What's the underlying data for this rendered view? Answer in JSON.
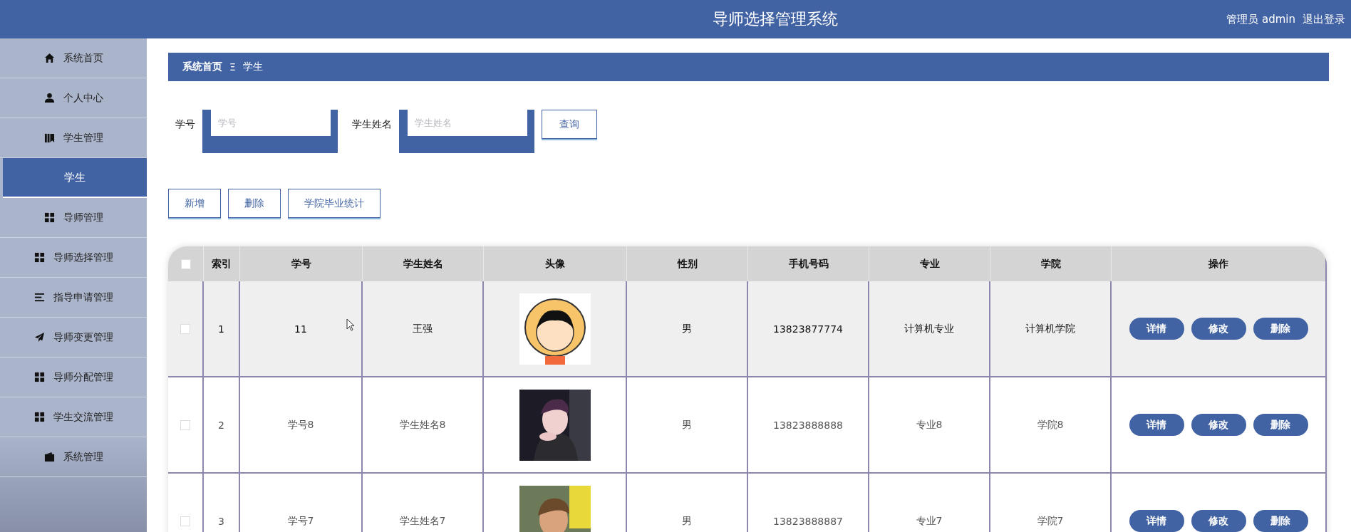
{
  "header": {
    "title": "导师选择管理系统",
    "user": "管理员 admin",
    "logout": "退出登录"
  },
  "sidebar": {
    "items": [
      {
        "label": "系统首页",
        "selected": false
      },
      {
        "label": "个人中心",
        "selected": false
      },
      {
        "label": "学生管理",
        "selected": false,
        "expanded": true,
        "children": [
          {
            "label": "学生",
            "selected": true
          }
        ]
      },
      {
        "label": "导师管理",
        "selected": false
      },
      {
        "label": "导师选择管理",
        "selected": false
      },
      {
        "label": "指导申请管理",
        "selected": false
      },
      {
        "label": "导师变更管理",
        "selected": false
      },
      {
        "label": "导师分配管理",
        "selected": false
      },
      {
        "label": "学生交流管理",
        "selected": false
      },
      {
        "label": "系统管理",
        "selected": false
      }
    ]
  },
  "breadcrumb": {
    "items": [
      "系统首页",
      "学生"
    ],
    "separator": "Ξ"
  },
  "search": {
    "fields": [
      {
        "label": "学号",
        "placeholder": "学号"
      },
      {
        "label": "学生姓名",
        "placeholder": "学生姓名"
      }
    ],
    "button": "查询"
  },
  "actions": [
    "新增",
    "删除",
    "学院毕业统计"
  ],
  "table": {
    "header_checked": false,
    "columns": [
      "索引",
      "学号",
      "学生姓名",
      "头像",
      "性别",
      "手机号码",
      "专业",
      "学院",
      "操作"
    ],
    "rows": [
      {
        "checked": false,
        "hovered": true,
        "cells": [
          "1",
          "11",
          "王强",
          "",
          "男",
          "13823877774",
          "计算机专业",
          "计算机学院"
        ],
        "avatar": {
          "kind": "picture"
        },
        "buttons": [
          "详情",
          "修改",
          "删除"
        ]
      },
      {
        "checked": false,
        "hovered": false,
        "cells": [
          "2",
          "学号8",
          "学生姓名8",
          "",
          "男",
          "13823888888",
          "专业8",
          "学院8"
        ],
        "avatar": {
          "kind": "picture"
        },
        "buttons": [
          "详情",
          "修改",
          "删除"
        ]
      },
      {
        "checked": false,
        "hovered": false,
        "cells": [
          "3",
          "学号7",
          "学生姓名7",
          "",
          "男",
          "13823888887",
          "专业7",
          "学院7"
        ],
        "avatar": {
          "kind": "picture"
        },
        "buttons": [
          "详情",
          "修改",
          "删除"
        ]
      }
    ]
  }
}
